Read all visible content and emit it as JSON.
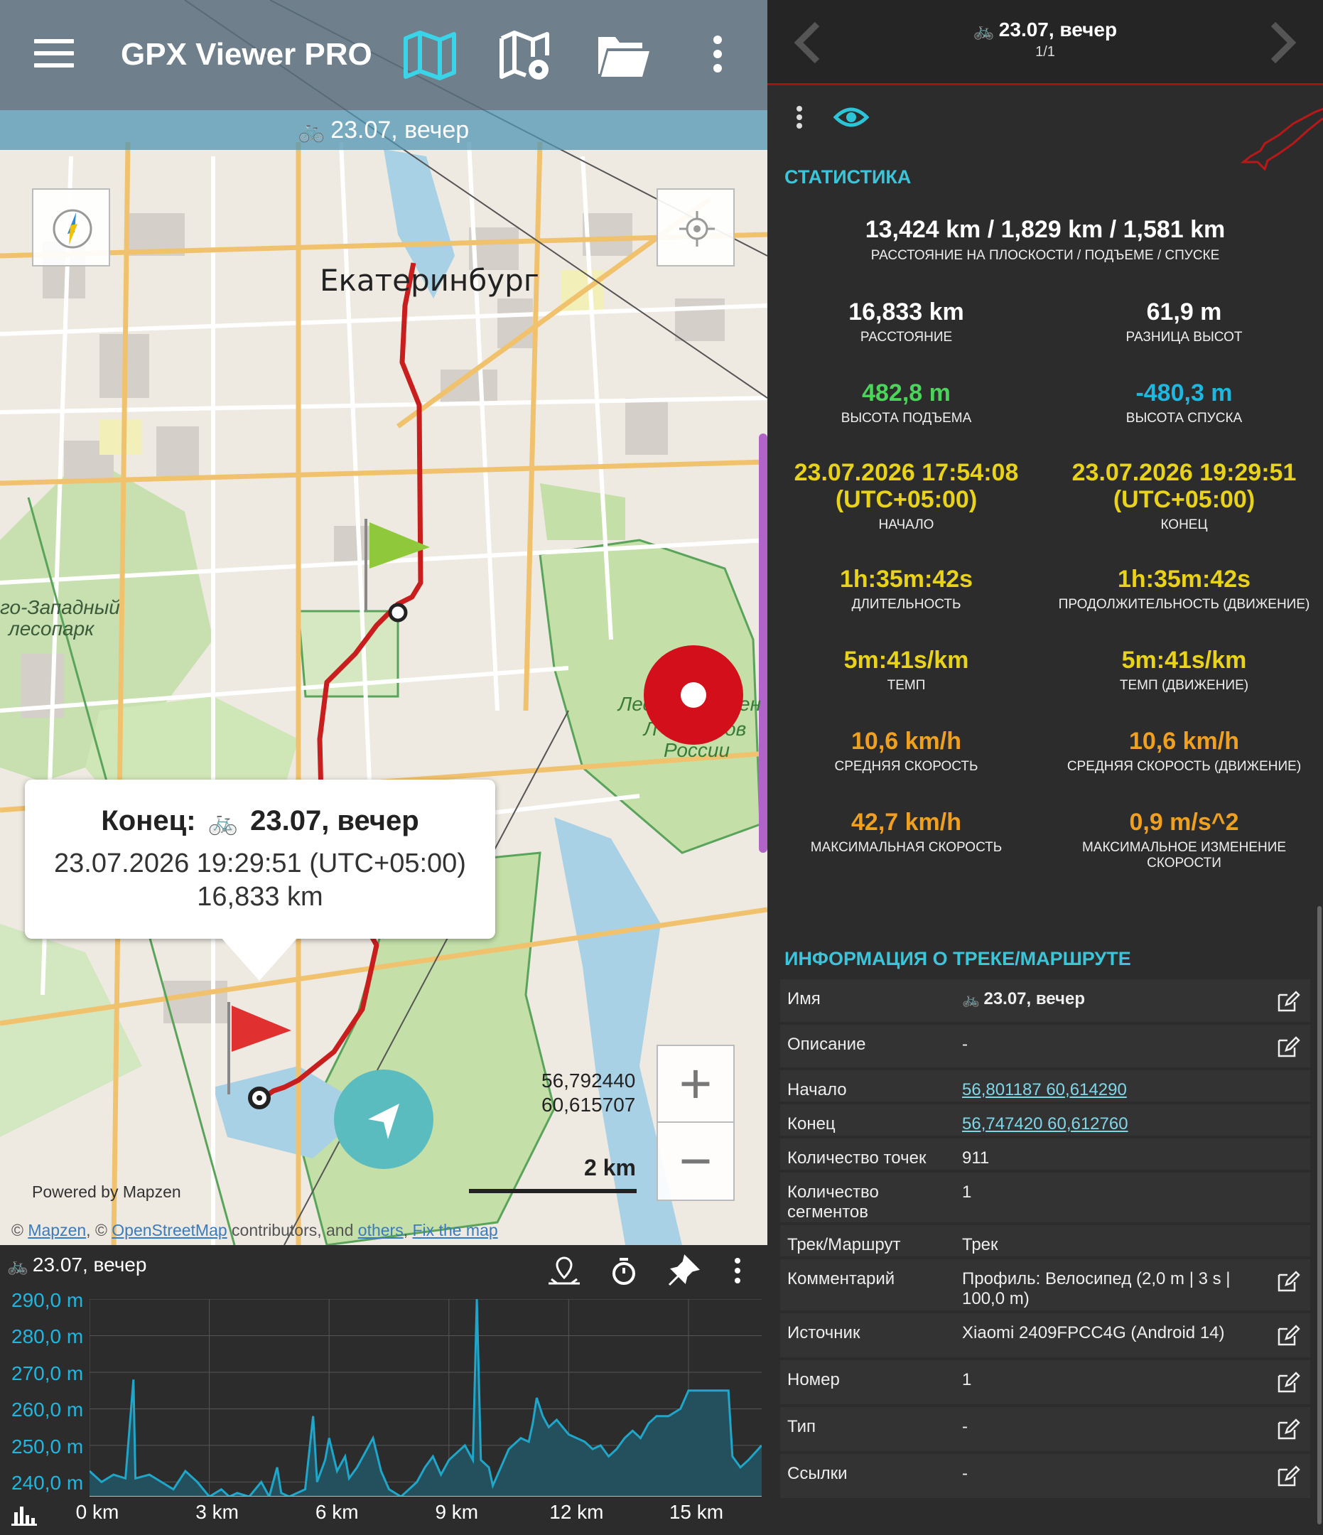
{
  "appbar": {
    "title": "GPX Viewer PRO",
    "icons": [
      "menu-icon",
      "map-icon",
      "map-settings-icon",
      "folder-icon",
      "more-vert-icon"
    ]
  },
  "track_bar": {
    "label": "23.07, вечер",
    "icon": "bicycle-icon"
  },
  "map": {
    "city_label": "Екатеринбург",
    "forest_label_line1": "го-Западный",
    "forest_label_line2": "лесопарк",
    "park_label_line1": "Лес",
    "park_label_line2": "ен",
    "park_label_line3": "Л",
    "park_label_line4": "ов",
    "park_label_line5": "России",
    "coords_line1": "56,792440",
    "coords_line2": "60,615707",
    "scale_label": "2 km",
    "powered_by": "Powered by Mapzen",
    "attribution": {
      "prefix": "© ",
      "mapzen": "Mapzen",
      "sep": ", © ",
      "osm": "OpenStreetMap",
      "mid": " contributors, and ",
      "others": "others",
      "comma": ", ",
      "fix": "Fix the map"
    },
    "zoom_in": "+",
    "zoom_out": "−",
    "colors": {
      "track": "#c81e1e",
      "record": "#d20f1a",
      "nav": "#5bbcbf"
    }
  },
  "popup": {
    "title_prefix": "Конец:",
    "title_name": "23.07, вечер",
    "time": "23.07.2026 19:29:51 (UTC+05:00)",
    "distance": "16,833 km"
  },
  "elevation": {
    "track_name": "23.07, вечер",
    "y_labels": [
      "290,0 m",
      "280,0 m",
      "270,0 m",
      "260,0 m",
      "250,0 m",
      "240,0 m"
    ],
    "x_labels": [
      "0 km",
      "3 km",
      "6 km",
      "9 km",
      "12 km",
      "15 km"
    ],
    "y_range": [
      236,
      290
    ],
    "x_range": [
      0,
      16.833
    ],
    "profile": [
      [
        0,
        243
      ],
      [
        0.3,
        240
      ],
      [
        0.6,
        242
      ],
      [
        0.9,
        241
      ],
      [
        1.1,
        268
      ],
      [
        1.15,
        241
      ],
      [
        1.5,
        242
      ],
      [
        1.8,
        240
      ],
      [
        2.1,
        238
      ],
      [
        2.4,
        243
      ],
      [
        2.7,
        240
      ],
      [
        3,
        236
      ],
      [
        3.3,
        238
      ],
      [
        3.5,
        236
      ],
      [
        3.7,
        237
      ],
      [
        4,
        236
      ],
      [
        4.3,
        240
      ],
      [
        4.5,
        236
      ],
      [
        4.7,
        244
      ],
      [
        4.8,
        237
      ],
      [
        5,
        236
      ],
      [
        5.4,
        238
      ],
      [
        5.6,
        258
      ],
      [
        5.7,
        240
      ],
      [
        5.9,
        246
      ],
      [
        6,
        252
      ],
      [
        6.2,
        243
      ],
      [
        6.4,
        247
      ],
      [
        6.5,
        241
      ],
      [
        6.7,
        244
      ],
      [
        6.9,
        248
      ],
      [
        7.1,
        252
      ],
      [
        7.3,
        243
      ],
      [
        7.5,
        238
      ],
      [
        7.8,
        236
      ],
      [
        8,
        238
      ],
      [
        8.2,
        240
      ],
      [
        8.4,
        244
      ],
      [
        8.6,
        247
      ],
      [
        8.8,
        242
      ],
      [
        9,
        246
      ],
      [
        9.2,
        248
      ],
      [
        9.4,
        250
      ],
      [
        9.6,
        246
      ],
      [
        9.7,
        290
      ],
      [
        9.8,
        246
      ],
      [
        10,
        244
      ],
      [
        10.1,
        239
      ],
      [
        10.3,
        244
      ],
      [
        10.5,
        249
      ],
      [
        10.8,
        252
      ],
      [
        11,
        251
      ],
      [
        11.1,
        256
      ],
      [
        11.2,
        263
      ],
      [
        11.35,
        258
      ],
      [
        11.5,
        255
      ],
      [
        11.7,
        257
      ],
      [
        12,
        253
      ],
      [
        12.2,
        252
      ],
      [
        12.4,
        251
      ],
      [
        12.6,
        249
      ],
      [
        12.8,
        250
      ],
      [
        13,
        247
      ],
      [
        13.2,
        249
      ],
      [
        13.4,
        252
      ],
      [
        13.6,
        254
      ],
      [
        13.8,
        252
      ],
      [
        14,
        256
      ],
      [
        14.2,
        258
      ],
      [
        14.5,
        258
      ],
      [
        14.8,
        260
      ],
      [
        15,
        265
      ],
      [
        15.5,
        265
      ],
      [
        16,
        265
      ],
      [
        16.1,
        247
      ],
      [
        16.3,
        244
      ],
      [
        16.5,
        246
      ],
      [
        16.833,
        250
      ]
    ],
    "colors": {
      "line": "#1fa6c9",
      "fill": "#24505e"
    }
  },
  "panel": {
    "nav_title": "23.07, вечер",
    "nav_sub": "1/1",
    "section_stats": "СТАТИСТИКА",
    "stats_top": {
      "value": "13,424 km / 1,829 km / 1,581 km",
      "label": "РАССТОЯНИЕ НА ПЛОСКОСТИ / ПОДЪЕМЕ / СПУСКЕ"
    },
    "stats": [
      {
        "value": "16,833 km",
        "label": "РАССТОЯНИЕ",
        "color": "#ffffff"
      },
      {
        "value": "61,9 m",
        "label": "РАЗНИЦА ВЫСОТ",
        "color": "#ffffff"
      },
      {
        "value": "482,8 m",
        "label": "ВЫСОТА ПОДЪЕМА",
        "color": "#4cd45a"
      },
      {
        "value": "-480,3 m",
        "label": "ВЫСОТА СПУСКА",
        "color": "#1fb7e0"
      },
      {
        "value": "23.07.2026 17:54:08\n(UTC+05:00)",
        "label": "НАЧАЛО",
        "color": "#e8d21a"
      },
      {
        "value": "23.07.2026 19:29:51\n(UTC+05:00)",
        "label": "КОНЕЦ",
        "color": "#e8d21a"
      },
      {
        "value": "1h:35m:42s",
        "label": "ДЛИТЕЛЬНОСТЬ",
        "color": "#e8d21a"
      },
      {
        "value": "1h:35m:42s",
        "label": "ПРОДОЛЖИТЕЛЬНОСТЬ (ДВИЖЕНИЕ)",
        "color": "#e8d21a"
      },
      {
        "value": "5m:41s/km",
        "label": "ТЕМП",
        "color": "#e8d21a"
      },
      {
        "value": "5m:41s/km",
        "label": "ТЕМП (ДВИЖЕНИЕ)",
        "color": "#e8d21a"
      },
      {
        "value": "10,6 km/h",
        "label": "СРЕДНЯЯ СКОРОСТЬ",
        "color": "#f0a020"
      },
      {
        "value": "10,6 km/h",
        "label": "СРЕДНЯЯ СКОРОСТЬ (ДВИЖЕНИЕ)",
        "color": "#f0a020"
      },
      {
        "value": "42,7 km/h",
        "label": "МАКСИМАЛЬНАЯ СКОРОСТЬ",
        "color": "#f0a020"
      },
      {
        "value": "0,9 m/s^2",
        "label": "МАКСИМАЛЬНОЕ ИЗМЕНЕНИЕ\nСКОРОСТИ",
        "color": "#f0a020"
      }
    ],
    "section_info": "ИНФОРМАЦИЯ О ТРЕКЕ/МАРШРУТЕ",
    "info": [
      {
        "key": "Имя",
        "value": "23.07, вечер",
        "bike": true,
        "edit": true
      },
      {
        "key": "Описание",
        "value": "-",
        "edit": true
      },
      {
        "key": "Начало",
        "value": "56,801187 60,614290",
        "link": true
      },
      {
        "key": "Конец",
        "value": "56,747420 60,612760",
        "link": true
      },
      {
        "key": "Количество точек",
        "value": "911"
      },
      {
        "key": "Количество\nсегментов",
        "value": "1"
      },
      {
        "key": "Трек/Маршрут",
        "value": "Трек"
      },
      {
        "key": "Комментарий",
        "value": "Профиль: Велосипед (2,0 m | 3 s |\n100,0 m)",
        "edit": true
      },
      {
        "key": "Источник",
        "value": "Xiaomi 2409FPCC4G (Android 14)",
        "edit": true
      },
      {
        "key": "Номер",
        "value": "1",
        "edit": true
      },
      {
        "key": "Тип",
        "value": "-",
        "edit": true
      },
      {
        "key": "Ссылки",
        "value": "-",
        "edit": true
      }
    ]
  }
}
